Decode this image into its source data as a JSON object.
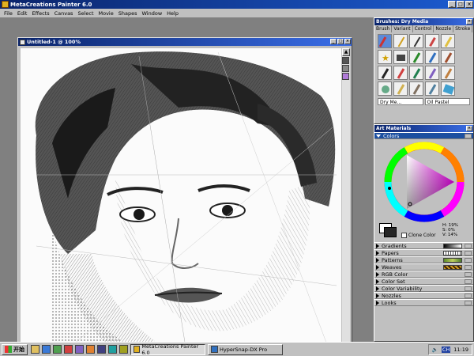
{
  "app": {
    "title": "MetaCreations Painter 6.0"
  },
  "menu": [
    "File",
    "Edit",
    "Effects",
    "Canvas",
    "Select",
    "Movie",
    "Shapes",
    "Window",
    "Help"
  ],
  "document": {
    "title": "Untitled-1 @ 100%"
  },
  "brushes_panel": {
    "title": "Brushes: Dry Media",
    "tabs": [
      "Brush",
      "Variant",
      "Control",
      "Nozzle",
      "Stroke"
    ],
    "footer_left": "Dry Me...",
    "footer_right": "Oil Pastel"
  },
  "art_materials": {
    "title": "Art Materials",
    "colors_label": "Colors",
    "hsv": {
      "h": "H: 19%",
      "s": "S: 0%",
      "v": "V: 14%"
    },
    "clone_color": "Clone Color",
    "primary_color": "#ffffff",
    "secondary_color": "#262626",
    "sections": [
      "Gradients",
      "Papers",
      "Patterns",
      "Weaves",
      "RGB Color",
      "Color Set",
      "Color Variability",
      "Nozzles",
      "Looks"
    ]
  },
  "taskbar": {
    "start": "开始",
    "tasks": [
      "MetaCreations Painter 6.0",
      "HyperSnap-DX Pro"
    ],
    "time": "11:19",
    "ime": "CH"
  },
  "colors": {
    "titlebar": "#0a246a",
    "chrome": "#c0c0c0",
    "workspace": "#808080"
  }
}
